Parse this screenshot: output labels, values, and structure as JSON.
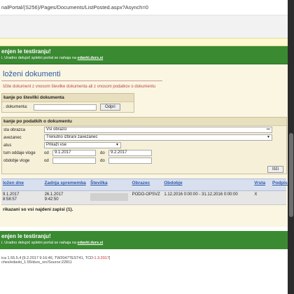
{
  "browser": {
    "url": "nalPortal/(S256)/Pages/Documents/ListPosted.aspx?Asynch=0"
  },
  "banner": {
    "title": "enjen le testiranju!",
    "subtitle_prefix": "i. Uradno delujoč spletni portal se nahaja na ",
    "subtitle_link": "edavki.durs.si"
  },
  "page": {
    "title": "loženi dokumenti",
    "description": "ščite dokument z vnosom številke dokumenta ali z vnosom podatkov o dokumentu"
  },
  "search_number": {
    "heading": "kanje po številki dokumenta",
    "label": ". dokumenta:",
    "value": "",
    "button": "Odpri"
  },
  "search_data": {
    "heading": "kanje po podatkih o dokumentu",
    "fields": {
      "type_label": "sta obrazca",
      "type_value": "Vsi obrazci",
      "taxpayer_label": "avezanec",
      "taxpayer_value": "Trenutno izbrani zavezanec",
      "status_label": "atus",
      "status_value": "Prikaži vse",
      "date_label": "tum oddaje vloge",
      "date_from_label": "od",
      "date_from": "9.1.2017",
      "date_to_label": "do",
      "date_to": "9.2.2017",
      "period_label": "obdobje vloge",
      "period_from_label": "od",
      "period_from": "",
      "period_to_label": "do",
      "period_to": ""
    },
    "search_button": "Išči"
  },
  "table": {
    "headers": [
      "ložen dne",
      "Zadnja sprememba",
      "Številka",
      "Obrazec",
      "Obdobje",
      "Vrsta",
      "Podpisn"
    ],
    "rows": [
      {
        "posted": "9.1.2017",
        "posted_time": "8:58:57",
        "changed": "26.1.2017",
        "changed_time": "9:42:50",
        "number": "",
        "form": "PODO-OPSVZ",
        "period": "1.12.2016 0:00:00 - 31.12.2016 0:00:00",
        "type": "X",
        "signed": ""
      }
    ],
    "count_text": "rikazani so vsi najdeni zapisi (1)."
  },
  "footer": {
    "banner_title": "enjen le testiranju!",
    "banner_prefix": "i. Uradno delujoč spletni portal se nahaja na ",
    "banner_link": "edavki.durs.si",
    "version_prefix": "ica 1.55.5.4 [9.2.2017 9:16:46, TW2047TEST41, TCD:",
    "version_red": "1.3.2017",
    "version_suffix": "]",
    "path": "ches/edavki_1.55/durs_src/Source:22811"
  }
}
